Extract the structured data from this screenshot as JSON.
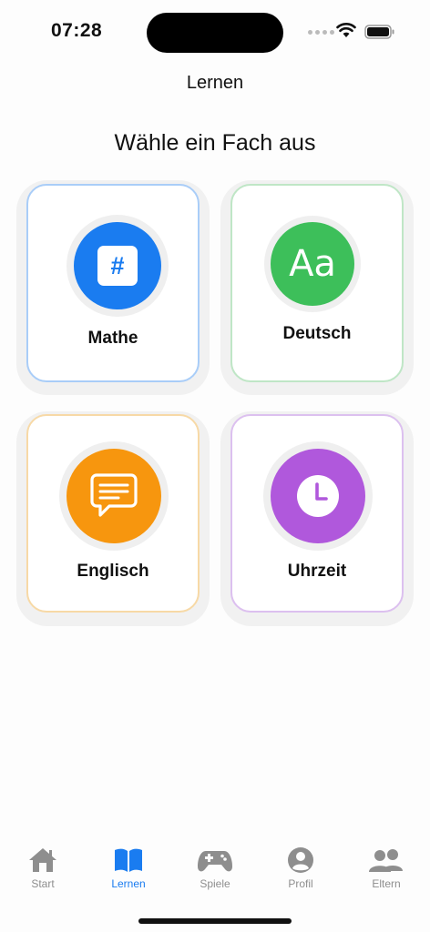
{
  "status_bar": {
    "time": "07:28"
  },
  "nav": {
    "title": "Lernen"
  },
  "heading": "Wähle ein Fach aus",
  "subjects": [
    {
      "label": "Mathe",
      "icon": "hash-icon",
      "icon_text": "#",
      "color": "#1a7cf0",
      "border": "#a9cdf8"
    },
    {
      "label": "Deutsch",
      "icon": "text-aa-icon",
      "icon_text": "Aa",
      "color": "#3dbf5a",
      "border": "#bfe6c6"
    },
    {
      "label": "Englisch",
      "icon": "speech-bubble-icon",
      "color": "#f7960e",
      "border": "#f7d9a6"
    },
    {
      "label": "Uhrzeit",
      "icon": "clock-icon",
      "color": "#b058dc",
      "border": "#dcc0ef"
    }
  ],
  "tabbar": {
    "items": [
      {
        "label": "Start",
        "icon": "house-icon",
        "active": false
      },
      {
        "label": "Lernen",
        "icon": "book-icon",
        "active": true
      },
      {
        "label": "Spiele",
        "icon": "gamepad-icon",
        "active": false
      },
      {
        "label": "Profil",
        "icon": "person-circle-icon",
        "active": false
      },
      {
        "label": "Eltern",
        "icon": "people-icon",
        "active": false
      }
    ]
  },
  "colors": {
    "accent": "#1a7cf0",
    "inactive": "#8e8e8e"
  }
}
